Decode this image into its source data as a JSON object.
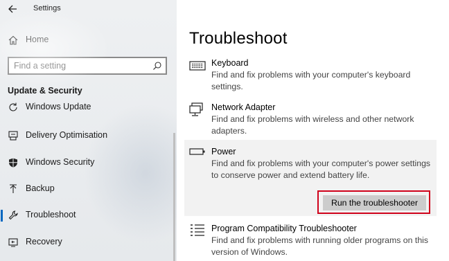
{
  "window": {
    "title": "Settings"
  },
  "sidebar": {
    "home_label": "Home",
    "search": {
      "placeholder": "Find a setting"
    },
    "section_title": "Update & Security",
    "items": [
      {
        "label": "Windows Update",
        "icon": "refresh-icon"
      },
      {
        "label": "Delivery Optimisation",
        "icon": "delivery-optimisation-icon"
      },
      {
        "label": "Windows Security",
        "icon": "shield-icon"
      },
      {
        "label": "Backup",
        "icon": "backup-icon"
      },
      {
        "label": "Troubleshoot",
        "icon": "wrench-icon",
        "selected": true
      },
      {
        "label": "Recovery",
        "icon": "recovery-icon"
      }
    ]
  },
  "main": {
    "title": "Troubleshoot",
    "items": [
      {
        "title": "Keyboard",
        "description": "Find and fix problems with your computer's keyboard settings.",
        "icon": "keyboard-icon"
      },
      {
        "title": "Network Adapter",
        "description": "Find and fix problems with wireless and other network adapters.",
        "icon": "network-adapter-icon"
      },
      {
        "title": "Power",
        "description": "Find and fix problems with your computer's power settings to conserve power and extend battery life.",
        "icon": "battery-icon",
        "expanded": true,
        "button_label": "Run the troubleshooter"
      },
      {
        "title": "Program Compatibility Troubleshooter",
        "description": "Find and fix problems with running older programs on this version of Windows.",
        "icon": "program-list-icon"
      }
    ]
  },
  "colors": {
    "accent": "#0067c0",
    "highlight_outline": "#d0021b",
    "button_bg": "#cccccc",
    "expanded_bg": "#f2f2f2"
  }
}
